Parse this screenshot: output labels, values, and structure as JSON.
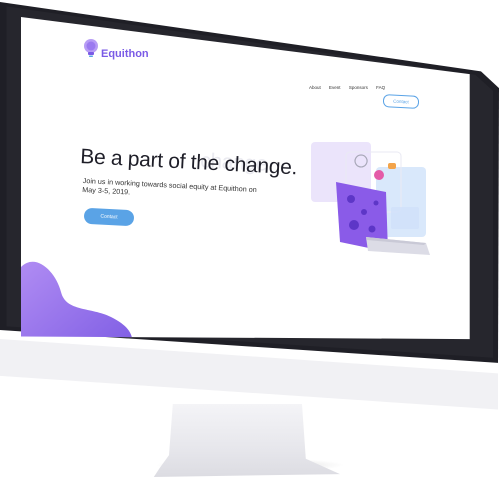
{
  "site": {
    "brand": "Equithon",
    "nav": [
      "About",
      "Event",
      "Sponsors",
      "FAQ"
    ],
    "nav_contact": "Contact"
  },
  "hero": {
    "title": "Be a part of the change.",
    "ghost_text": "change",
    "subtitle": "Join us in working towards social equity at Equithon on May 3-5, 2019.",
    "cta": "Contact"
  },
  "colors": {
    "brand_purple": "#7a5ae6",
    "accent_blue": "#5aa3e6",
    "bezel": "#1f1f26"
  },
  "icons": {
    "logo": "lightbulb-logo-icon"
  }
}
